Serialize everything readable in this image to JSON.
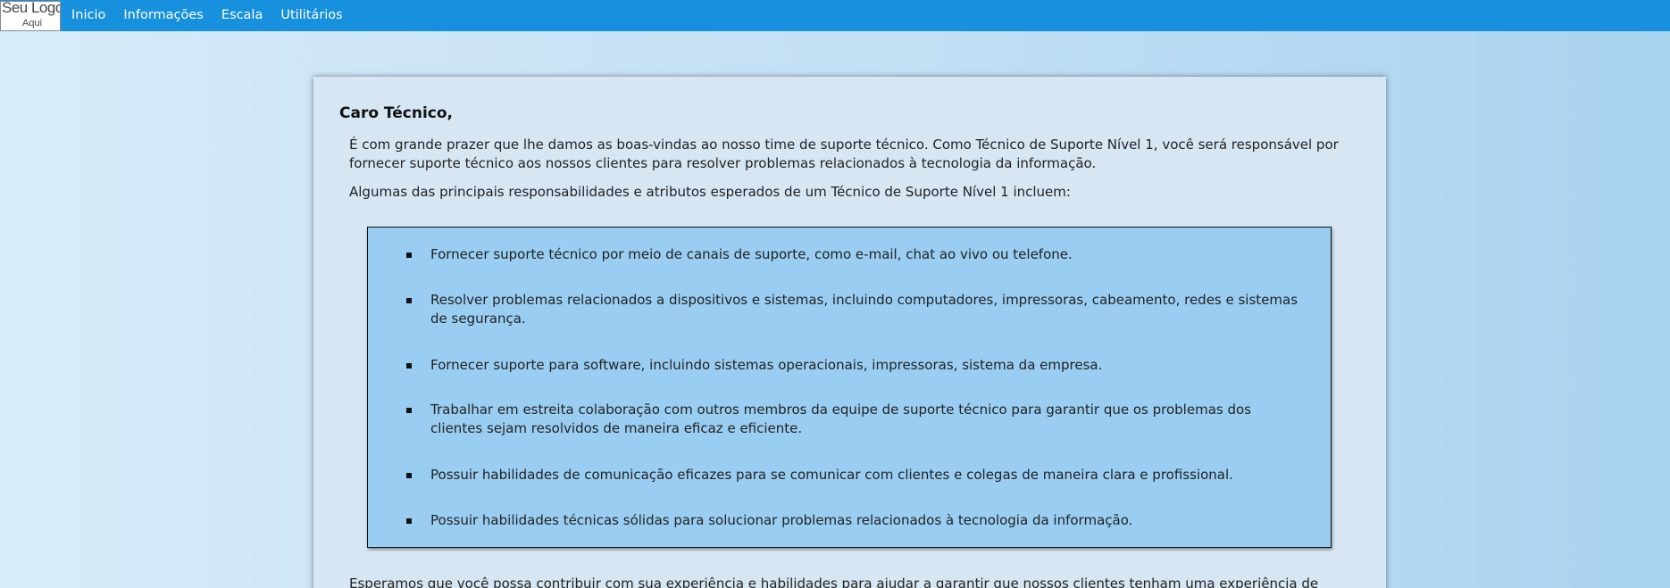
{
  "header": {
    "logo_line1": "Seu Logo",
    "logo_line2": "Aqui",
    "nav": [
      "Inicio",
      "Informações",
      "Escala",
      "Utilitários"
    ]
  },
  "content": {
    "greeting": "Caro Técnico,",
    "intro": "É com grande prazer que lhe damos as boas-vindas ao nosso time de suporte técnico. Como Técnico de Suporte Nível 1, você será responsável por fornecer suporte técnico aos nossos clientes para resolver problemas relacionados à tecnologia da informação.",
    "responsibilities_intro": "Algumas das principais responsabilidades e atributos esperados de um Técnico de Suporte Nível 1 incluem:",
    "responsibilities": [
      "Fornecer suporte técnico por meio de canais de suporte, como e-mail, chat ao vivo ou telefone.",
      "Resolver problemas relacionados a dispositivos e sistemas, incluindo computadores, impressoras, cabeamento, redes e sistemas de segurança.",
      "Fornecer suporte para software, incluindo sistemas operacionais, impressoras, sistema da empresa.",
      "Trabalhar em estreita colaboração com outros membros da equipe de suporte técnico para garantir que os problemas dos clientes sejam resolvidos de maneira eficaz e eficiente.",
      "Possuir habilidades de comunicação eficazes para se comunicar com clientes e colegas de maneira clara e profissional.",
      "Possuir habilidades técnicas sólidas para solucionar problemas relacionados à tecnologia da informação."
    ],
    "closing": "Esperamos que você possa contribuir com sua experiência e habilidades para ajudar a garantir que nossos clientes tenham uma experiência de suporte técnico"
  }
}
